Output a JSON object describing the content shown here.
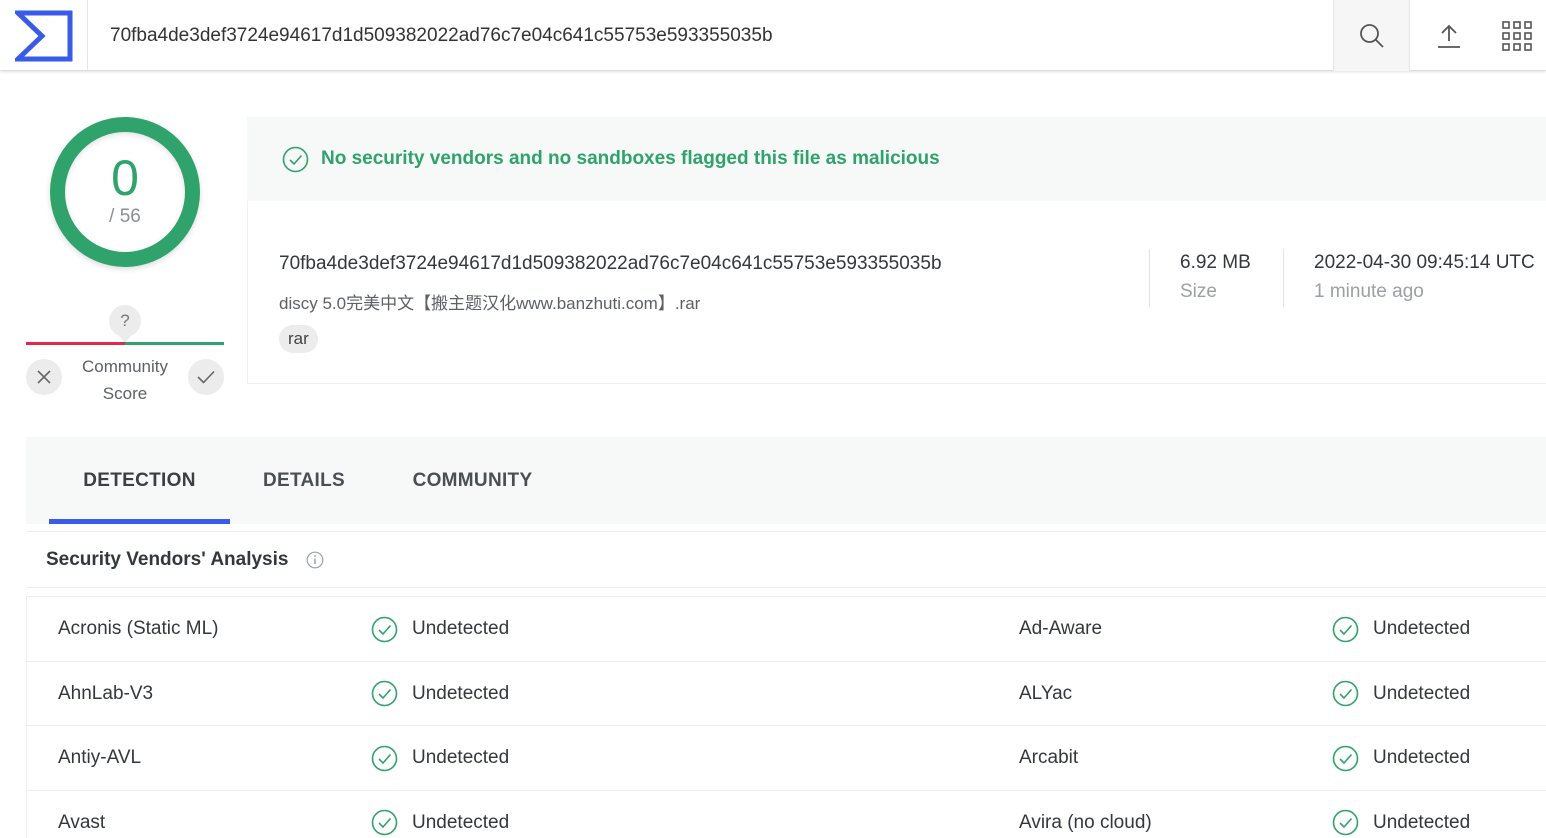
{
  "header": {
    "search_value": "70fba4de3def3724e94617d1d509382022ad76c7e04c641c55753e593355035b"
  },
  "colors": {
    "accent": "#3a5ae8",
    "clean": "#2fa36b",
    "malicious": "#e0294a"
  },
  "score": {
    "detections": "0",
    "total": "/ 56"
  },
  "community": {
    "question": "?",
    "label_line1": "Community",
    "label_line2": "Score"
  },
  "verdict": {
    "text": "No security vendors and no sandboxes flagged this file as malicious"
  },
  "file": {
    "hash": "70fba4de3def3724e94617d1d509382022ad76c7e04c641c55753e593355035b",
    "name": "discy 5.0完美中文【搬主题汉化www.banzhuti.com】.rar",
    "tag": "rar",
    "size_value": "6.92 MB",
    "size_label": "Size",
    "date_value": "2022-04-30 09:45:14 UTC",
    "date_label": "1 minute ago"
  },
  "tabs": [
    {
      "label": "DETECTION",
      "active": true
    },
    {
      "label": "DETAILS",
      "active": false
    },
    {
      "label": "COMMUNITY",
      "active": false
    }
  ],
  "analysis": {
    "title": "Security Vendors' Analysis"
  },
  "vendors": [
    {
      "left_name": "Acronis (Static ML)",
      "left_result": "Undetected",
      "right_name": "Ad-Aware",
      "right_result": "Undetected"
    },
    {
      "left_name": "AhnLab-V3",
      "left_result": "Undetected",
      "right_name": "ALYac",
      "right_result": "Undetected"
    },
    {
      "left_name": "Antiy-AVL",
      "left_result": "Undetected",
      "right_name": "Arcabit",
      "right_result": "Undetected"
    },
    {
      "left_name": "Avast",
      "left_result": "Undetected",
      "right_name": "Avira (no cloud)",
      "right_result": "Undetected"
    }
  ]
}
